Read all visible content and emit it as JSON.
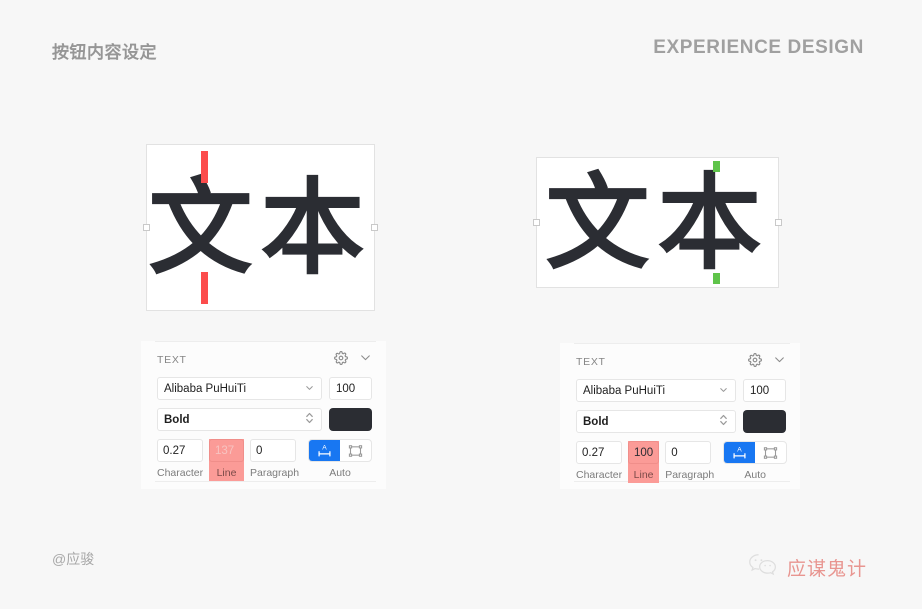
{
  "header": {
    "left_title": "按钮内容设定",
    "right_title": "EXPERIENCE DESIGN"
  },
  "canvas": {
    "left_frame": {
      "text": "文本",
      "indicator_color": "#fc4c4c",
      "indicator_label": "line-height-overflow"
    },
    "right_frame": {
      "text": "文本",
      "indicator_color": "#5fc44a",
      "indicator_label": "line-height-fit"
    }
  },
  "panels": [
    {
      "title": "TEXT",
      "gear_icon": "gear-icon",
      "collapse_icon": "chevron-down-icon",
      "font_family": "Alibaba PuHuiTi",
      "font_size": "100",
      "font_style": "Bold",
      "color_hex": "#2b2d33",
      "spacing": [
        {
          "name": "character",
          "value": "0.27",
          "label": "Character",
          "highlighted": false,
          "dim": false
        },
        {
          "name": "line",
          "value": "137",
          "label": "Line",
          "highlighted": true,
          "dim": true
        },
        {
          "name": "paragraph",
          "value": "0",
          "label": "Paragraph",
          "highlighted": false,
          "dim": false
        }
      ],
      "resize": {
        "label": "Auto",
        "auto_width_icon": "auto-width-icon",
        "fixed_size_icon": "fixed-size-icon",
        "active_hex": "#1877f2"
      }
    },
    {
      "title": "TEXT",
      "gear_icon": "gear-icon",
      "collapse_icon": "chevron-down-icon",
      "font_family": "Alibaba PuHuiTi",
      "font_size": "100",
      "font_style": "Bold",
      "color_hex": "#2b2d33",
      "spacing": [
        {
          "name": "character",
          "value": "0.27",
          "label": "Character",
          "highlighted": false,
          "dim": false
        },
        {
          "name": "line",
          "value": "100",
          "label": "Line",
          "highlighted": true,
          "dim": false
        },
        {
          "name": "paragraph",
          "value": "0",
          "label": "Paragraph",
          "highlighted": false,
          "dim": false
        }
      ],
      "resize": {
        "label": "Auto",
        "auto_width_icon": "auto-width-icon",
        "fixed_size_icon": "fixed-size-icon",
        "active_hex": "#1877f2"
      }
    }
  ],
  "watermarks": {
    "author": "@应骏",
    "brand": "应谋鬼计",
    "brand_icon": "wechat-icon",
    "brand_hex": "#e05a52"
  }
}
